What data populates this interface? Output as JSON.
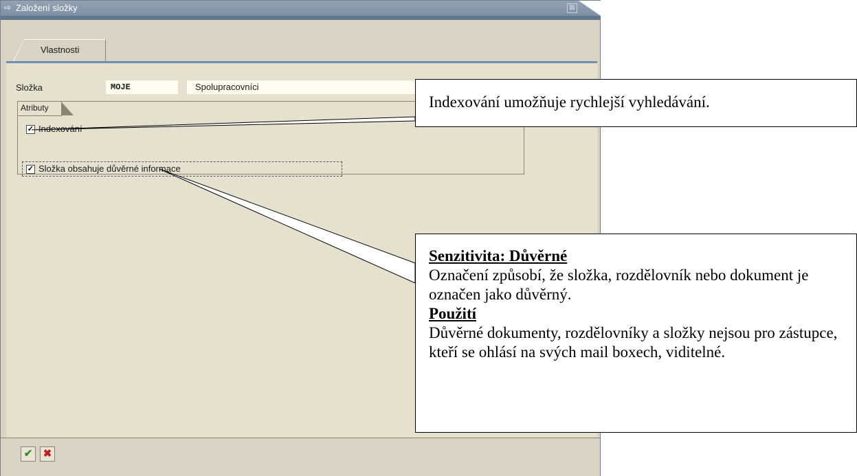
{
  "window": {
    "title": "Založení složky",
    "close_symbol": "⊠",
    "title_icon": "window-icon"
  },
  "tabs": [
    {
      "label": "Vlastnosti",
      "active": true
    }
  ],
  "folder": {
    "label": "Složka",
    "code": "MOJE",
    "name": "Spolupracovníci"
  },
  "attributes": {
    "group_title": "Atributy",
    "items": [
      {
        "label": "Indexování",
        "checked": true
      },
      {
        "label": "Složka obsahuje důvěrné informace",
        "checked": true
      }
    ]
  },
  "footer": {
    "confirm_icon": "checkmark-icon",
    "cancel_icon": "cross-icon"
  },
  "callouts": {
    "indexing": "Indexování umožňuje rychlejší vyhledávání.",
    "sensitivity": {
      "heading1": "Senzitivita: Důvěrné ",
      "text1": "Označení způsobí, že složka, rozdělovník nebo dokument je označen jako důvěrný.",
      "heading2": "Použití",
      "text2": "Důvěrné dokumenty, rozdělovníky a složky nejsou pro zástupce, kteří se ohlásí na svých mail boxech, viditelné."
    }
  },
  "colors": {
    "titlebar": "#8a9bb0",
    "panel": "#e6e0cf",
    "frame": "#d9d3c3",
    "accent_line": "#6f8fb0",
    "confirm": "#2e8b2e",
    "cancel": "#c0201a"
  }
}
